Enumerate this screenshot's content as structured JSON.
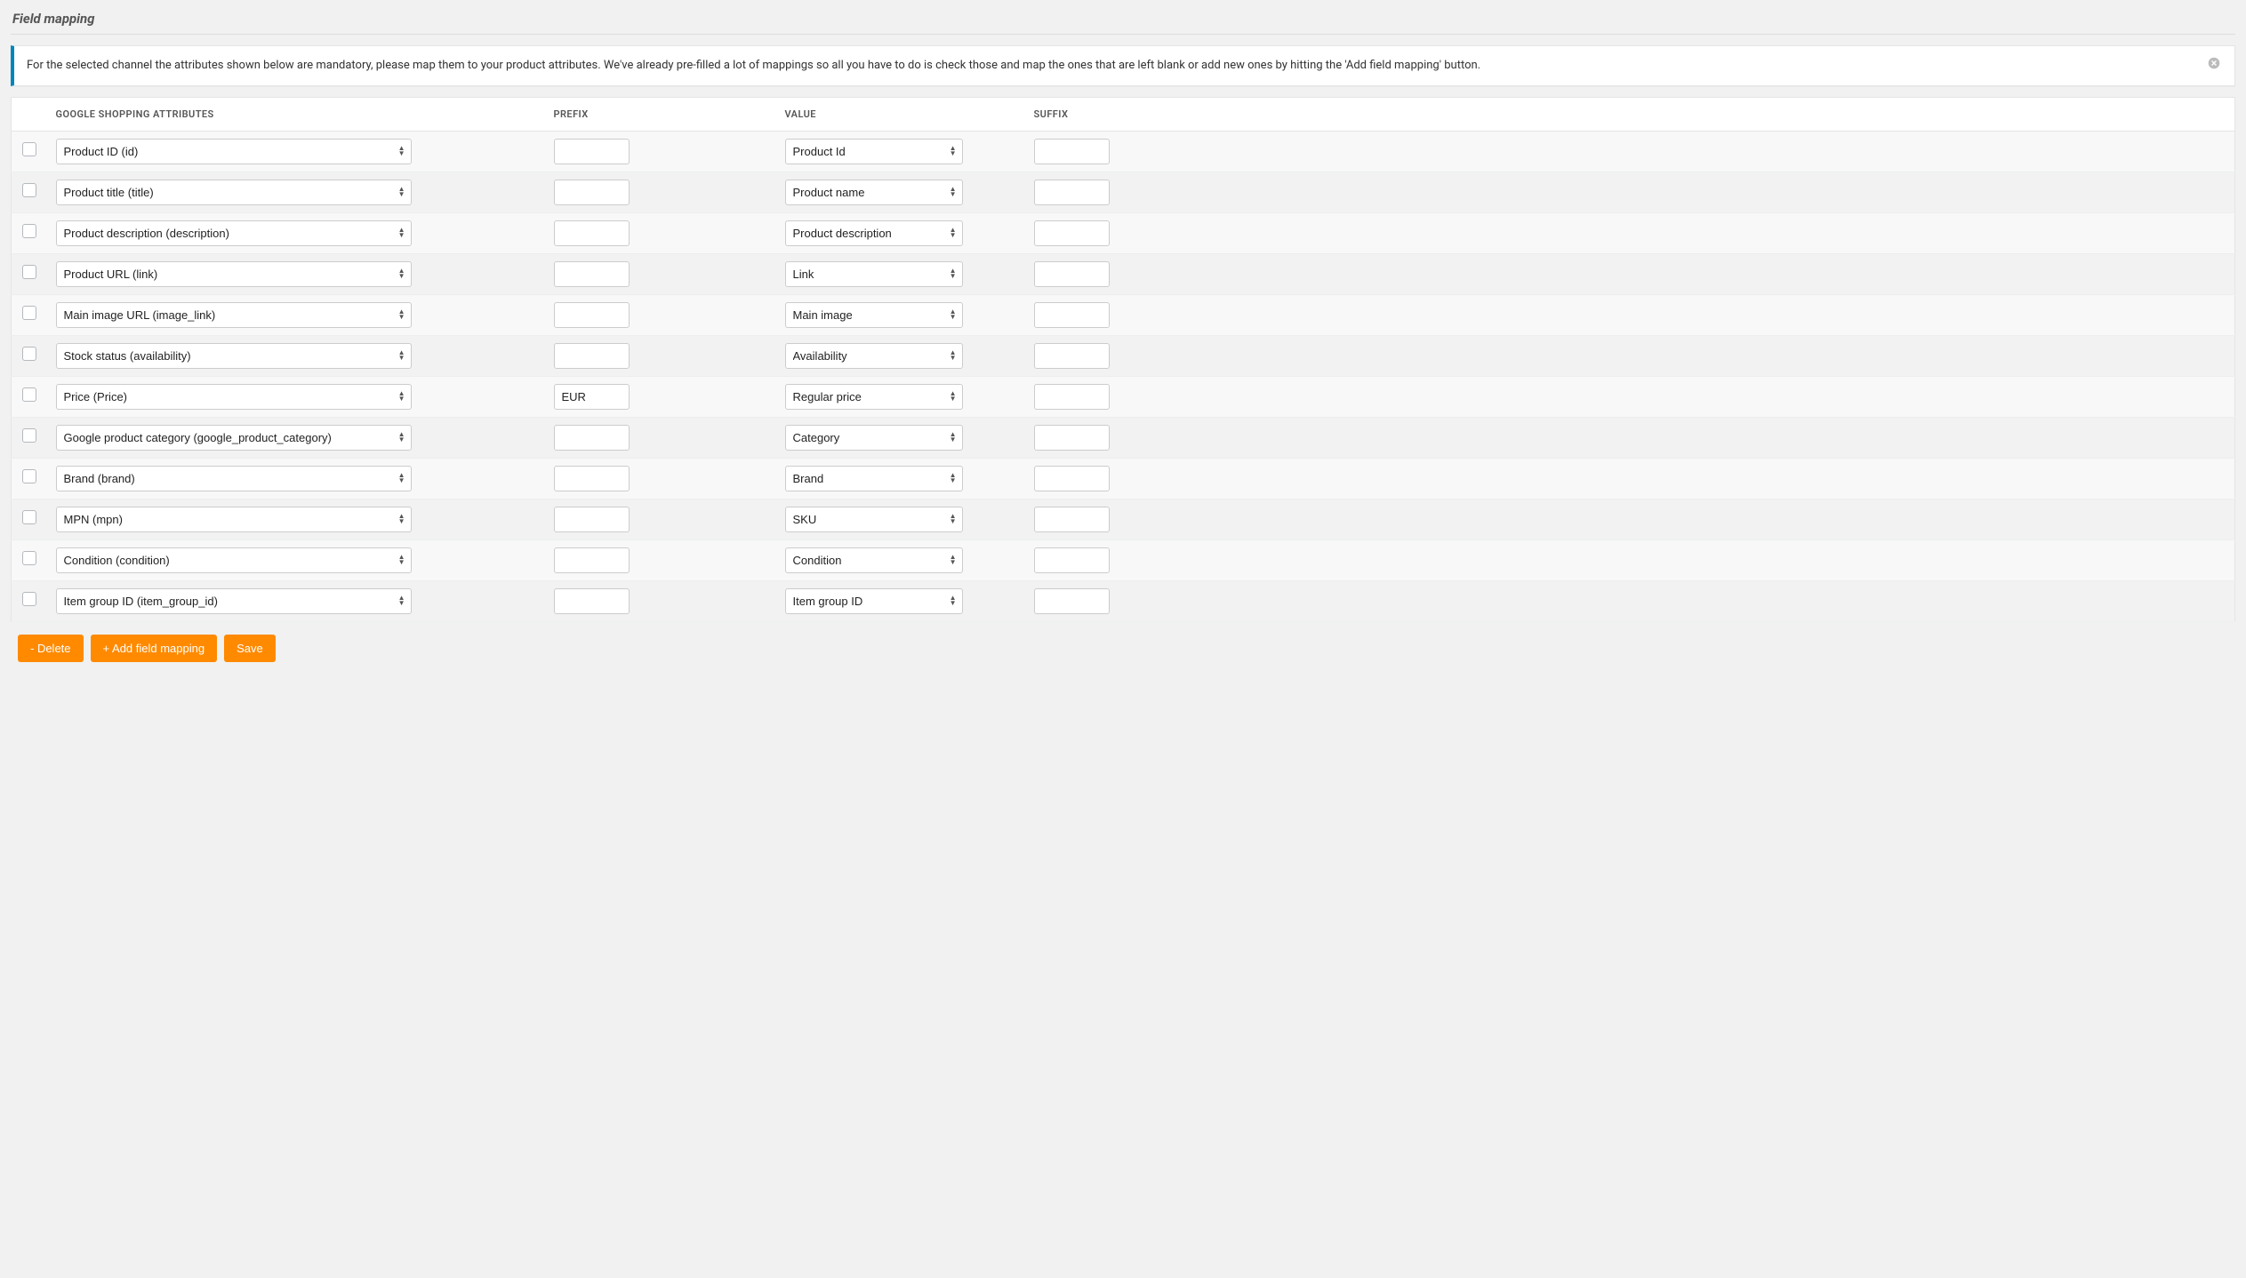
{
  "title": "Field mapping",
  "notice_text": "For the selected channel the attributes shown below are mandatory, please map them to your product attributes. We've already pre-filled a lot of mappings so all you have to do is check those and map the ones that are left blank or add new ones by hitting the 'Add field mapping' button.",
  "headers": {
    "check": "",
    "attr": "GOOGLE SHOPPING ATTRIBUTES",
    "prefix": "PREFIX",
    "value": "VALUE",
    "suffix": "SUFFIX"
  },
  "rows": [
    {
      "attr": "Product ID (id)",
      "prefix": "",
      "value": "Product Id",
      "suffix": ""
    },
    {
      "attr": "Product title (title)",
      "prefix": "",
      "value": "Product name",
      "suffix": ""
    },
    {
      "attr": "Product description (description)",
      "prefix": "",
      "value": "Product description",
      "suffix": ""
    },
    {
      "attr": "Product URL (link)",
      "prefix": "",
      "value": "Link",
      "suffix": ""
    },
    {
      "attr": "Main image URL (image_link)",
      "prefix": "",
      "value": "Main image",
      "suffix": ""
    },
    {
      "attr": "Stock status (availability)",
      "prefix": "",
      "value": "Availability",
      "suffix": ""
    },
    {
      "attr": "Price (Price)",
      "prefix": "EUR",
      "value": "Regular price",
      "suffix": ""
    },
    {
      "attr": "Google product category (google_product_category)",
      "prefix": "",
      "value": "Category",
      "suffix": ""
    },
    {
      "attr": "Brand (brand)",
      "prefix": "",
      "value": "Brand",
      "suffix": ""
    },
    {
      "attr": "MPN (mpn)",
      "prefix": "",
      "value": "SKU",
      "suffix": ""
    },
    {
      "attr": "Condition (condition)",
      "prefix": "",
      "value": "Condition",
      "suffix": ""
    },
    {
      "attr": "Item group ID (item_group_id)",
      "prefix": "",
      "value": "Item group ID",
      "suffix": ""
    }
  ],
  "buttons": {
    "delete": "- Delete",
    "add": "+ Add field mapping",
    "save": "Save"
  }
}
